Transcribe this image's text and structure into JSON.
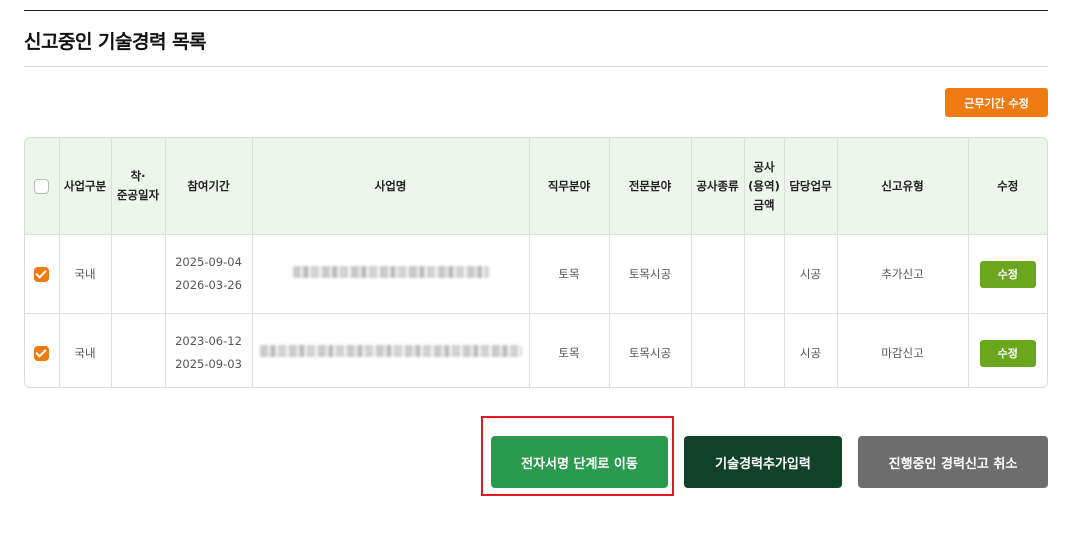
{
  "page": {
    "title": "신고중인 기술경력 목록"
  },
  "toolbar": {
    "edit_period_label": "근무기간 수정"
  },
  "table": {
    "headers": {
      "category": "사업구분",
      "start_completion_line1": "착·",
      "start_completion_line2": "준공일자",
      "participation_period": "참여기간",
      "project_name": "사업명",
      "job_field": "직무분야",
      "specialty_field": "전문분야",
      "construction_type": "공사종류",
      "amount_line1": "공사",
      "amount_line2": "(용역)",
      "amount_line3": "금액",
      "duty": "담당업무",
      "report_type": "신고유형",
      "edit": "수정"
    },
    "rows": [
      {
        "checked": true,
        "category": "국내",
        "start_completion": "",
        "period_start": "2025-09-04",
        "period_end": "2026-03-26",
        "project_name": "",
        "job_field": "토목",
        "specialty_field": "토목시공",
        "construction_type": "",
        "amount": "",
        "duty": "시공",
        "report_type": "추가신고",
        "edit_label": "수정"
      },
      {
        "checked": true,
        "category": "국내",
        "start_completion": "",
        "period_start": "2023-06-12",
        "period_end": "2025-09-03",
        "project_name": "",
        "job_field": "토목",
        "specialty_field": "토목시공",
        "construction_type": "",
        "amount": "",
        "duty": "시공",
        "report_type": "마감신고",
        "edit_label": "수정"
      }
    ]
  },
  "actions": {
    "sign_label": "전자서명 단계로 이동",
    "add_label": "기술경력추가입력",
    "cancel_label": "진행중인 경력신고 취소"
  },
  "colors": {
    "accent_orange": "#f07b12",
    "edit_green": "#6aa71c",
    "sign_green": "#2a9a4e",
    "dark_green": "#10422a",
    "gray": "#6d6d6d",
    "highlight_red": "#e01b1b"
  }
}
